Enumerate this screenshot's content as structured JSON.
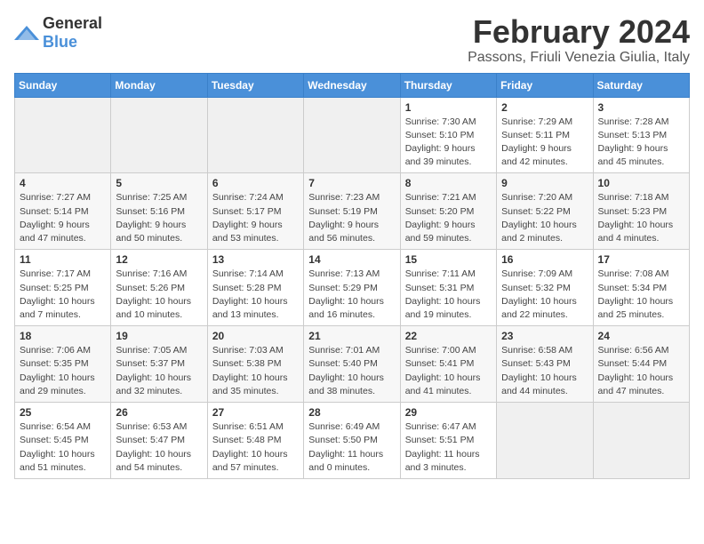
{
  "logo": {
    "general": "General",
    "blue": "Blue"
  },
  "title": "February 2024",
  "subtitle": "Passons, Friuli Venezia Giulia, Italy",
  "weekdays": [
    "Sunday",
    "Monday",
    "Tuesday",
    "Wednesday",
    "Thursday",
    "Friday",
    "Saturday"
  ],
  "weeks": [
    [
      {
        "day": "",
        "info": ""
      },
      {
        "day": "",
        "info": ""
      },
      {
        "day": "",
        "info": ""
      },
      {
        "day": "",
        "info": ""
      },
      {
        "day": "1",
        "info": "Sunrise: 7:30 AM\nSunset: 5:10 PM\nDaylight: 9 hours\nand 39 minutes."
      },
      {
        "day": "2",
        "info": "Sunrise: 7:29 AM\nSunset: 5:11 PM\nDaylight: 9 hours\nand 42 minutes."
      },
      {
        "day": "3",
        "info": "Sunrise: 7:28 AM\nSunset: 5:13 PM\nDaylight: 9 hours\nand 45 minutes."
      }
    ],
    [
      {
        "day": "4",
        "info": "Sunrise: 7:27 AM\nSunset: 5:14 PM\nDaylight: 9 hours\nand 47 minutes."
      },
      {
        "day": "5",
        "info": "Sunrise: 7:25 AM\nSunset: 5:16 PM\nDaylight: 9 hours\nand 50 minutes."
      },
      {
        "day": "6",
        "info": "Sunrise: 7:24 AM\nSunset: 5:17 PM\nDaylight: 9 hours\nand 53 minutes."
      },
      {
        "day": "7",
        "info": "Sunrise: 7:23 AM\nSunset: 5:19 PM\nDaylight: 9 hours\nand 56 minutes."
      },
      {
        "day": "8",
        "info": "Sunrise: 7:21 AM\nSunset: 5:20 PM\nDaylight: 9 hours\nand 59 minutes."
      },
      {
        "day": "9",
        "info": "Sunrise: 7:20 AM\nSunset: 5:22 PM\nDaylight: 10 hours\nand 2 minutes."
      },
      {
        "day": "10",
        "info": "Sunrise: 7:18 AM\nSunset: 5:23 PM\nDaylight: 10 hours\nand 4 minutes."
      }
    ],
    [
      {
        "day": "11",
        "info": "Sunrise: 7:17 AM\nSunset: 5:25 PM\nDaylight: 10 hours\nand 7 minutes."
      },
      {
        "day": "12",
        "info": "Sunrise: 7:16 AM\nSunset: 5:26 PM\nDaylight: 10 hours\nand 10 minutes."
      },
      {
        "day": "13",
        "info": "Sunrise: 7:14 AM\nSunset: 5:28 PM\nDaylight: 10 hours\nand 13 minutes."
      },
      {
        "day": "14",
        "info": "Sunrise: 7:13 AM\nSunset: 5:29 PM\nDaylight: 10 hours\nand 16 minutes."
      },
      {
        "day": "15",
        "info": "Sunrise: 7:11 AM\nSunset: 5:31 PM\nDaylight: 10 hours\nand 19 minutes."
      },
      {
        "day": "16",
        "info": "Sunrise: 7:09 AM\nSunset: 5:32 PM\nDaylight: 10 hours\nand 22 minutes."
      },
      {
        "day": "17",
        "info": "Sunrise: 7:08 AM\nSunset: 5:34 PM\nDaylight: 10 hours\nand 25 minutes."
      }
    ],
    [
      {
        "day": "18",
        "info": "Sunrise: 7:06 AM\nSunset: 5:35 PM\nDaylight: 10 hours\nand 29 minutes."
      },
      {
        "day": "19",
        "info": "Sunrise: 7:05 AM\nSunset: 5:37 PM\nDaylight: 10 hours\nand 32 minutes."
      },
      {
        "day": "20",
        "info": "Sunrise: 7:03 AM\nSunset: 5:38 PM\nDaylight: 10 hours\nand 35 minutes."
      },
      {
        "day": "21",
        "info": "Sunrise: 7:01 AM\nSunset: 5:40 PM\nDaylight: 10 hours\nand 38 minutes."
      },
      {
        "day": "22",
        "info": "Sunrise: 7:00 AM\nSunset: 5:41 PM\nDaylight: 10 hours\nand 41 minutes."
      },
      {
        "day": "23",
        "info": "Sunrise: 6:58 AM\nSunset: 5:43 PM\nDaylight: 10 hours\nand 44 minutes."
      },
      {
        "day": "24",
        "info": "Sunrise: 6:56 AM\nSunset: 5:44 PM\nDaylight: 10 hours\nand 47 minutes."
      }
    ],
    [
      {
        "day": "25",
        "info": "Sunrise: 6:54 AM\nSunset: 5:45 PM\nDaylight: 10 hours\nand 51 minutes."
      },
      {
        "day": "26",
        "info": "Sunrise: 6:53 AM\nSunset: 5:47 PM\nDaylight: 10 hours\nand 54 minutes."
      },
      {
        "day": "27",
        "info": "Sunrise: 6:51 AM\nSunset: 5:48 PM\nDaylight: 10 hours\nand 57 minutes."
      },
      {
        "day": "28",
        "info": "Sunrise: 6:49 AM\nSunset: 5:50 PM\nDaylight: 11 hours\nand 0 minutes."
      },
      {
        "day": "29",
        "info": "Sunrise: 6:47 AM\nSunset: 5:51 PM\nDaylight: 11 hours\nand 3 minutes."
      },
      {
        "day": "",
        "info": ""
      },
      {
        "day": "",
        "info": ""
      }
    ]
  ]
}
